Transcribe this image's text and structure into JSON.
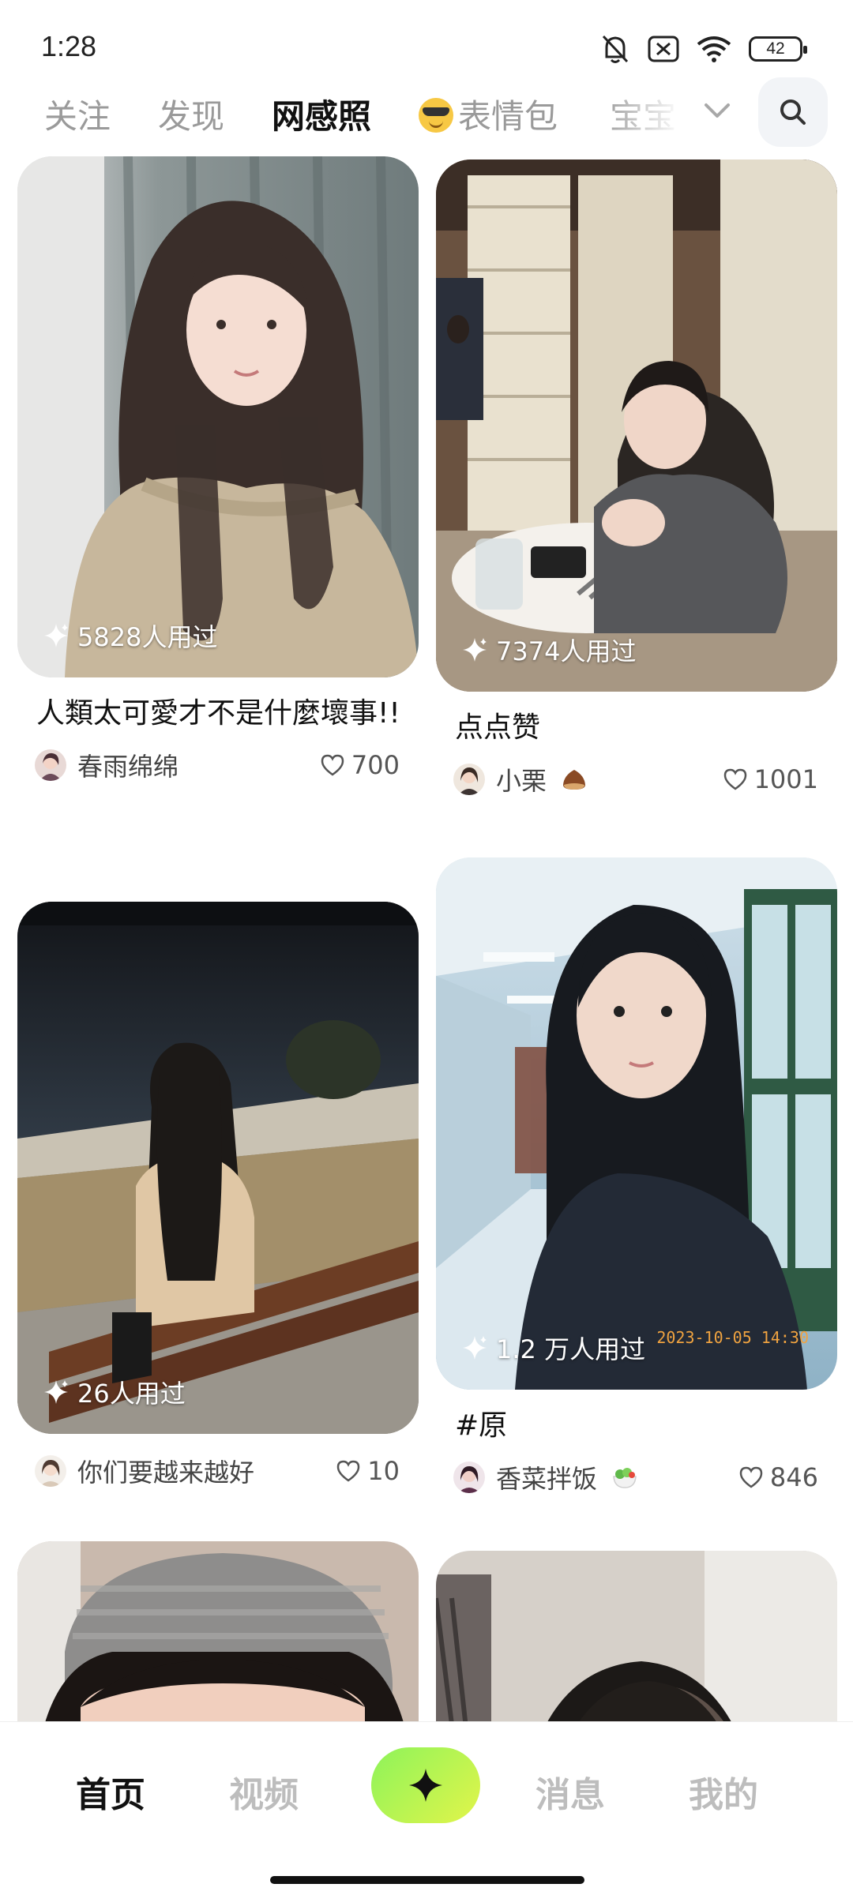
{
  "status_bar": {
    "time": "1:28",
    "battery": "42"
  },
  "top_tabs": [
    {
      "label": "关注",
      "active": false
    },
    {
      "label": "发现",
      "active": false
    },
    {
      "label": "网感照",
      "active": true
    },
    {
      "label": "表情包",
      "active": false,
      "icon": "sunglasses-emoji-icon"
    },
    {
      "label": "宝宝",
      "active": false
    }
  ],
  "feed": [
    {
      "usage": "5828人用过",
      "title": "人類太可愛才不是什麼壞事!!",
      "author": "春雨绵绵",
      "likes": "700"
    },
    {
      "usage": "7374人用过",
      "title": "点点赞",
      "author": "小栗",
      "author_emoji": "chestnut-icon",
      "likes": "1001"
    },
    {
      "usage": "26人用过",
      "title": "",
      "author": "你们要越来越好",
      "likes": "10"
    },
    {
      "usage": "1.2 万人用过",
      "timestamp": "2023-10-05 14:30",
      "title": "#原",
      "author": "香菜拌饭",
      "author_emoji": "salad-icon",
      "likes": "846"
    }
  ],
  "bottom_nav": [
    {
      "label": "首页",
      "active": true
    },
    {
      "label": "视频",
      "active": false
    },
    {
      "label": "消息",
      "active": false
    },
    {
      "label": "我的",
      "active": false
    }
  ],
  "colors": {
    "accent_green": "#c6f57a",
    "create_button": "#a8f04e",
    "timestamp": "#f0a340"
  }
}
